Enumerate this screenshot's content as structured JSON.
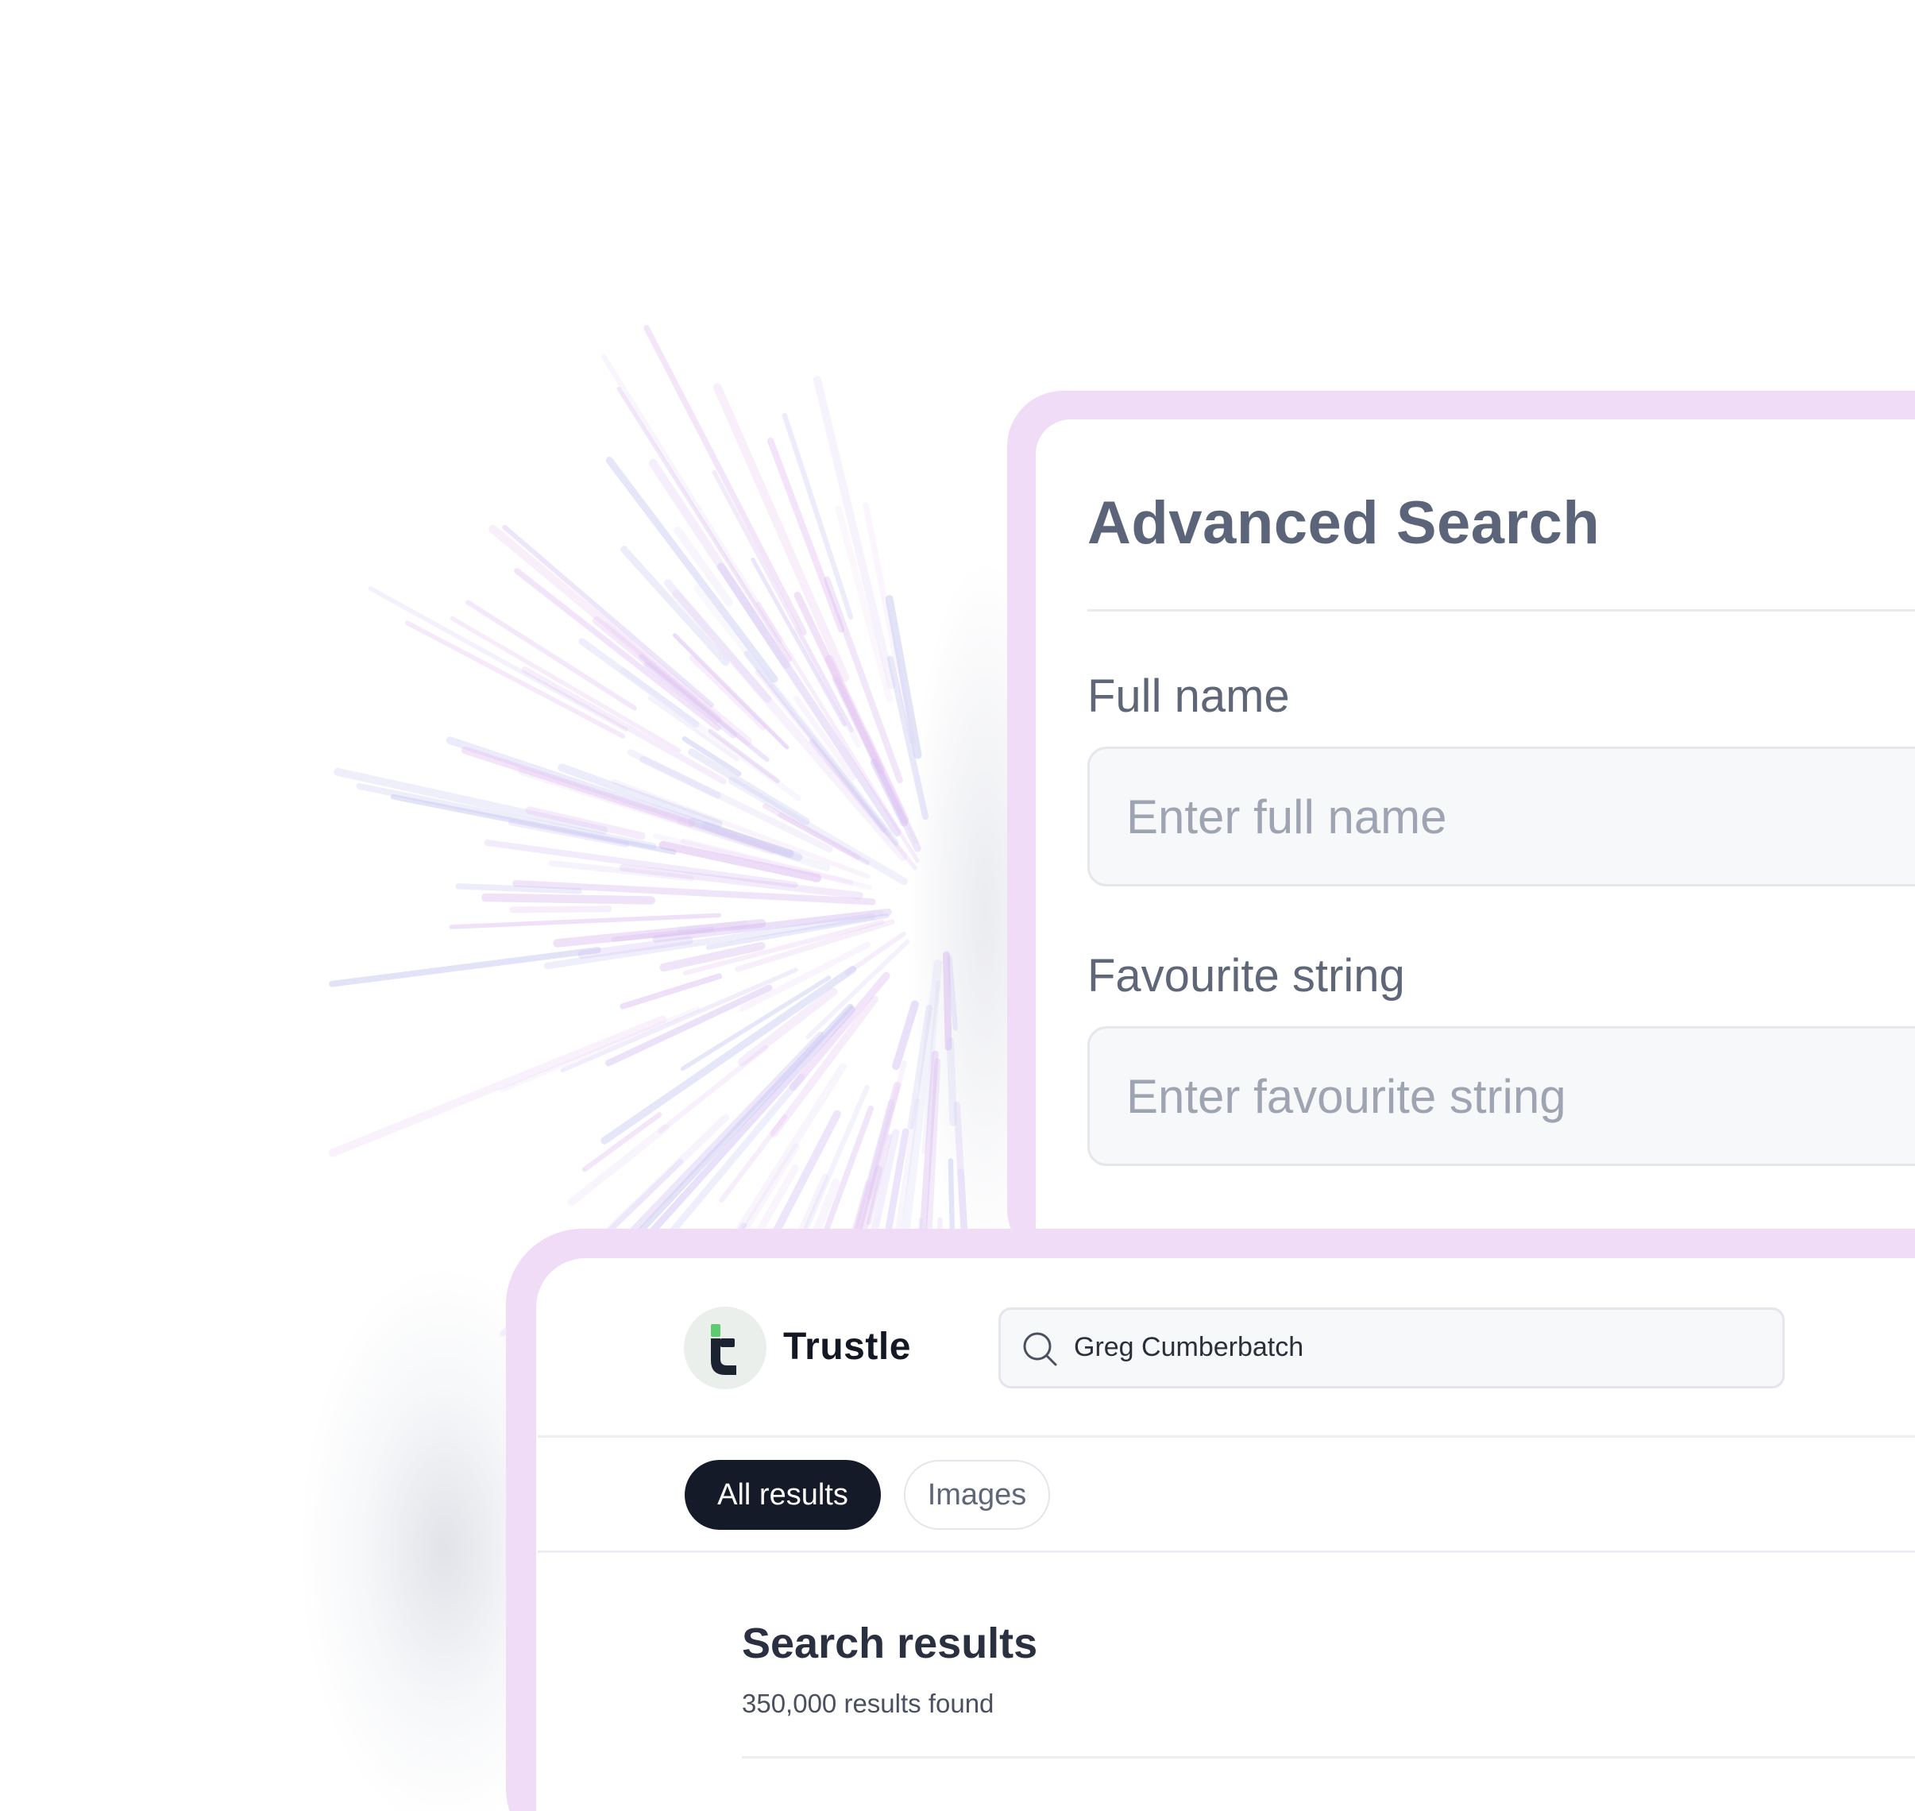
{
  "advanced_search": {
    "title": "Advanced Search",
    "fields": [
      {
        "label": "Full name",
        "placeholder": "Enter full name"
      },
      {
        "label": "Favourite string",
        "placeholder": "Enter favourite string"
      }
    ]
  },
  "app": {
    "brand_name": "Trustle",
    "logo_icon": "trustle-logo-icon",
    "search": {
      "icon": "search-icon",
      "value": "Greg Cumberbatch"
    },
    "tabs": [
      {
        "label": "All results",
        "active": true
      },
      {
        "label": "Images",
        "active": false
      }
    ],
    "results": {
      "title": "Search results",
      "count_text": "350,000 results found"
    }
  },
  "colors": {
    "frame_accent": "#f0dcf6",
    "burst_purple": "#d9b8ef",
    "burst_blue": "#c8c8f2",
    "tab_active_bg": "#141a28",
    "logo_green": "#5ccc6e",
    "logo_dark": "#1b2230"
  }
}
